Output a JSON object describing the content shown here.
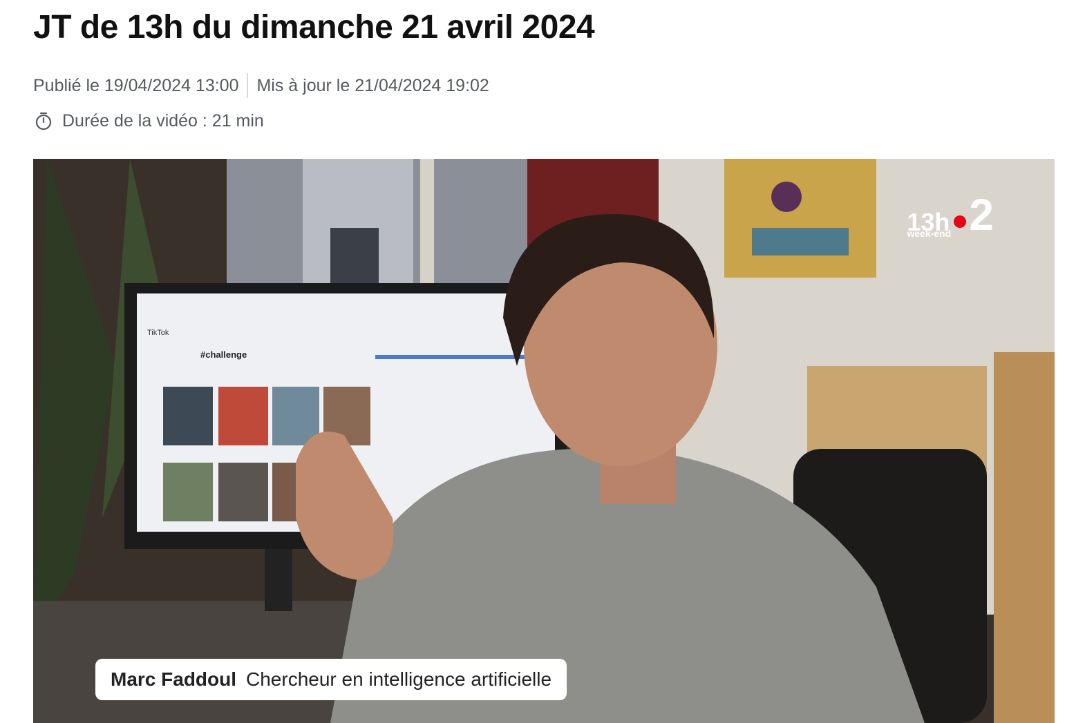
{
  "article": {
    "title": "JT de 13h du dimanche 21 avril 2024",
    "published": "Publié le 19/04/2024 13:00",
    "updated": "Mis à jour le 21/04/2024 19:02",
    "duration": "Durée de la vidéo : 21 min"
  },
  "video": {
    "logo_hour": "13h",
    "logo_channel": "2",
    "logo_sub": "week-end",
    "logo_dot_color": "#e30613",
    "lower_third": {
      "name": "Marc Faddoul",
      "role": "Chercheur en intelligence artificielle"
    },
    "screen_labels": {
      "app": "TikTok",
      "hashtag": "#challenge"
    }
  },
  "icons": {
    "duration": "timer-icon"
  }
}
